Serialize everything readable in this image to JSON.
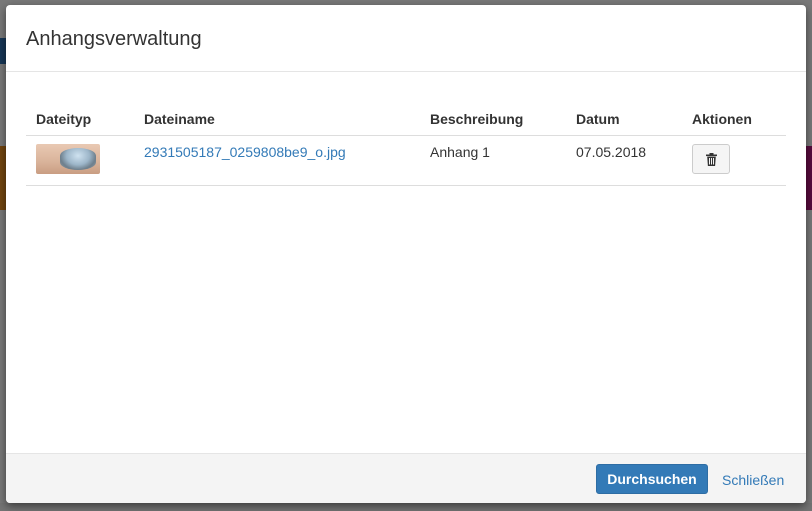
{
  "dialog": {
    "title": "Anhangsverwaltung"
  },
  "table": {
    "headers": {
      "type": "Dateityp",
      "name": "Dateiname",
      "description": "Beschreibung",
      "date": "Datum",
      "actions": "Aktionen"
    },
    "rows": [
      {
        "thumbnail": "image-thumbnail",
        "filename": "2931505187_0259808be9_o.jpg",
        "description": "Anhang 1",
        "date": "07.05.2018",
        "action_icon": "trash-icon"
      }
    ]
  },
  "footer": {
    "browse_label": "Durchsuchen",
    "close_label": "Schließen"
  },
  "colors": {
    "primary": "#337ab7",
    "link": "#337ab7",
    "text": "#333333"
  }
}
